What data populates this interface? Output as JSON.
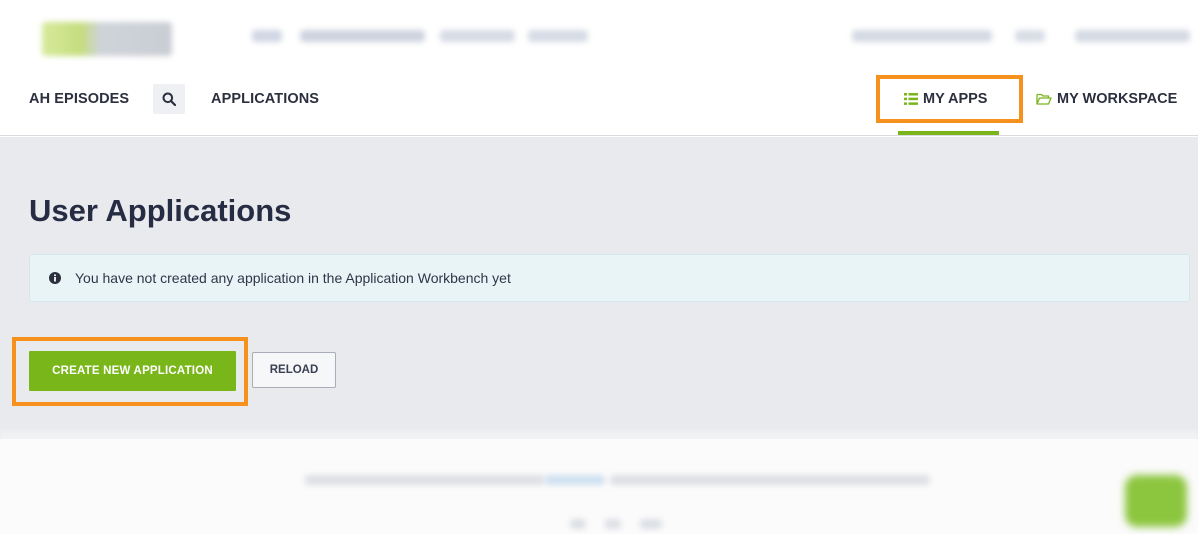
{
  "subnav": {
    "brand": "AH EPISODES",
    "applications": "APPLICATIONS",
    "my_apps": "MY APPS",
    "my_workspace": "MY WORKSPACE"
  },
  "icons": {
    "search": "search-icon",
    "list": "list-icon",
    "folder": "folder-open-icon",
    "info": "info-circle-icon"
  },
  "main": {
    "title": "User Applications",
    "info_message": "You have not created any application in the Application Workbench yet",
    "create_button": "CREATE NEW APPLICATION",
    "reload_button": "RELOAD"
  },
  "colors": {
    "accent": "#7ab51d",
    "highlight": "#f7911e",
    "title": "#262c43",
    "info_bg": "#e9f4f7"
  }
}
